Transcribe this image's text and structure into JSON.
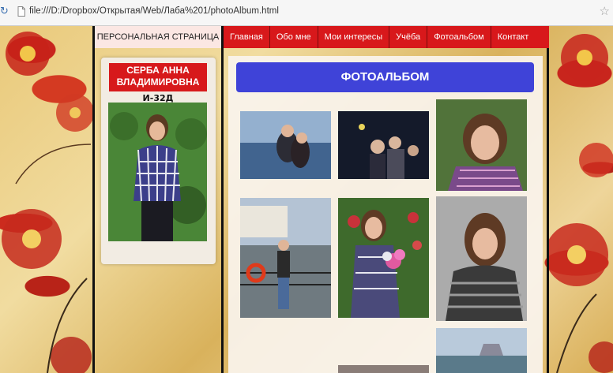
{
  "browser": {
    "url": "file:///D:/Dropbox/Открытая/Web/Лаба%201/photoAlbum.html"
  },
  "nav": {
    "home": "ПЕРСОНАЛЬНАЯ СТРАНИЦА",
    "items": [
      "Главная",
      "Обо мне",
      "Мои интересы",
      "Учёба",
      "Фотоальбом",
      "Контакт"
    ]
  },
  "sidebar": {
    "name_line1": "СЕРБА АННА",
    "name_line2": "ВЛАДИМИРОВНА",
    "group": "И-32Д"
  },
  "album": {
    "title": "ФОТОАЛЬБОМ"
  },
  "colors": {
    "nav_red": "#d8181b",
    "title_blue": "#3f43d8",
    "name_red": "#d7191b"
  }
}
